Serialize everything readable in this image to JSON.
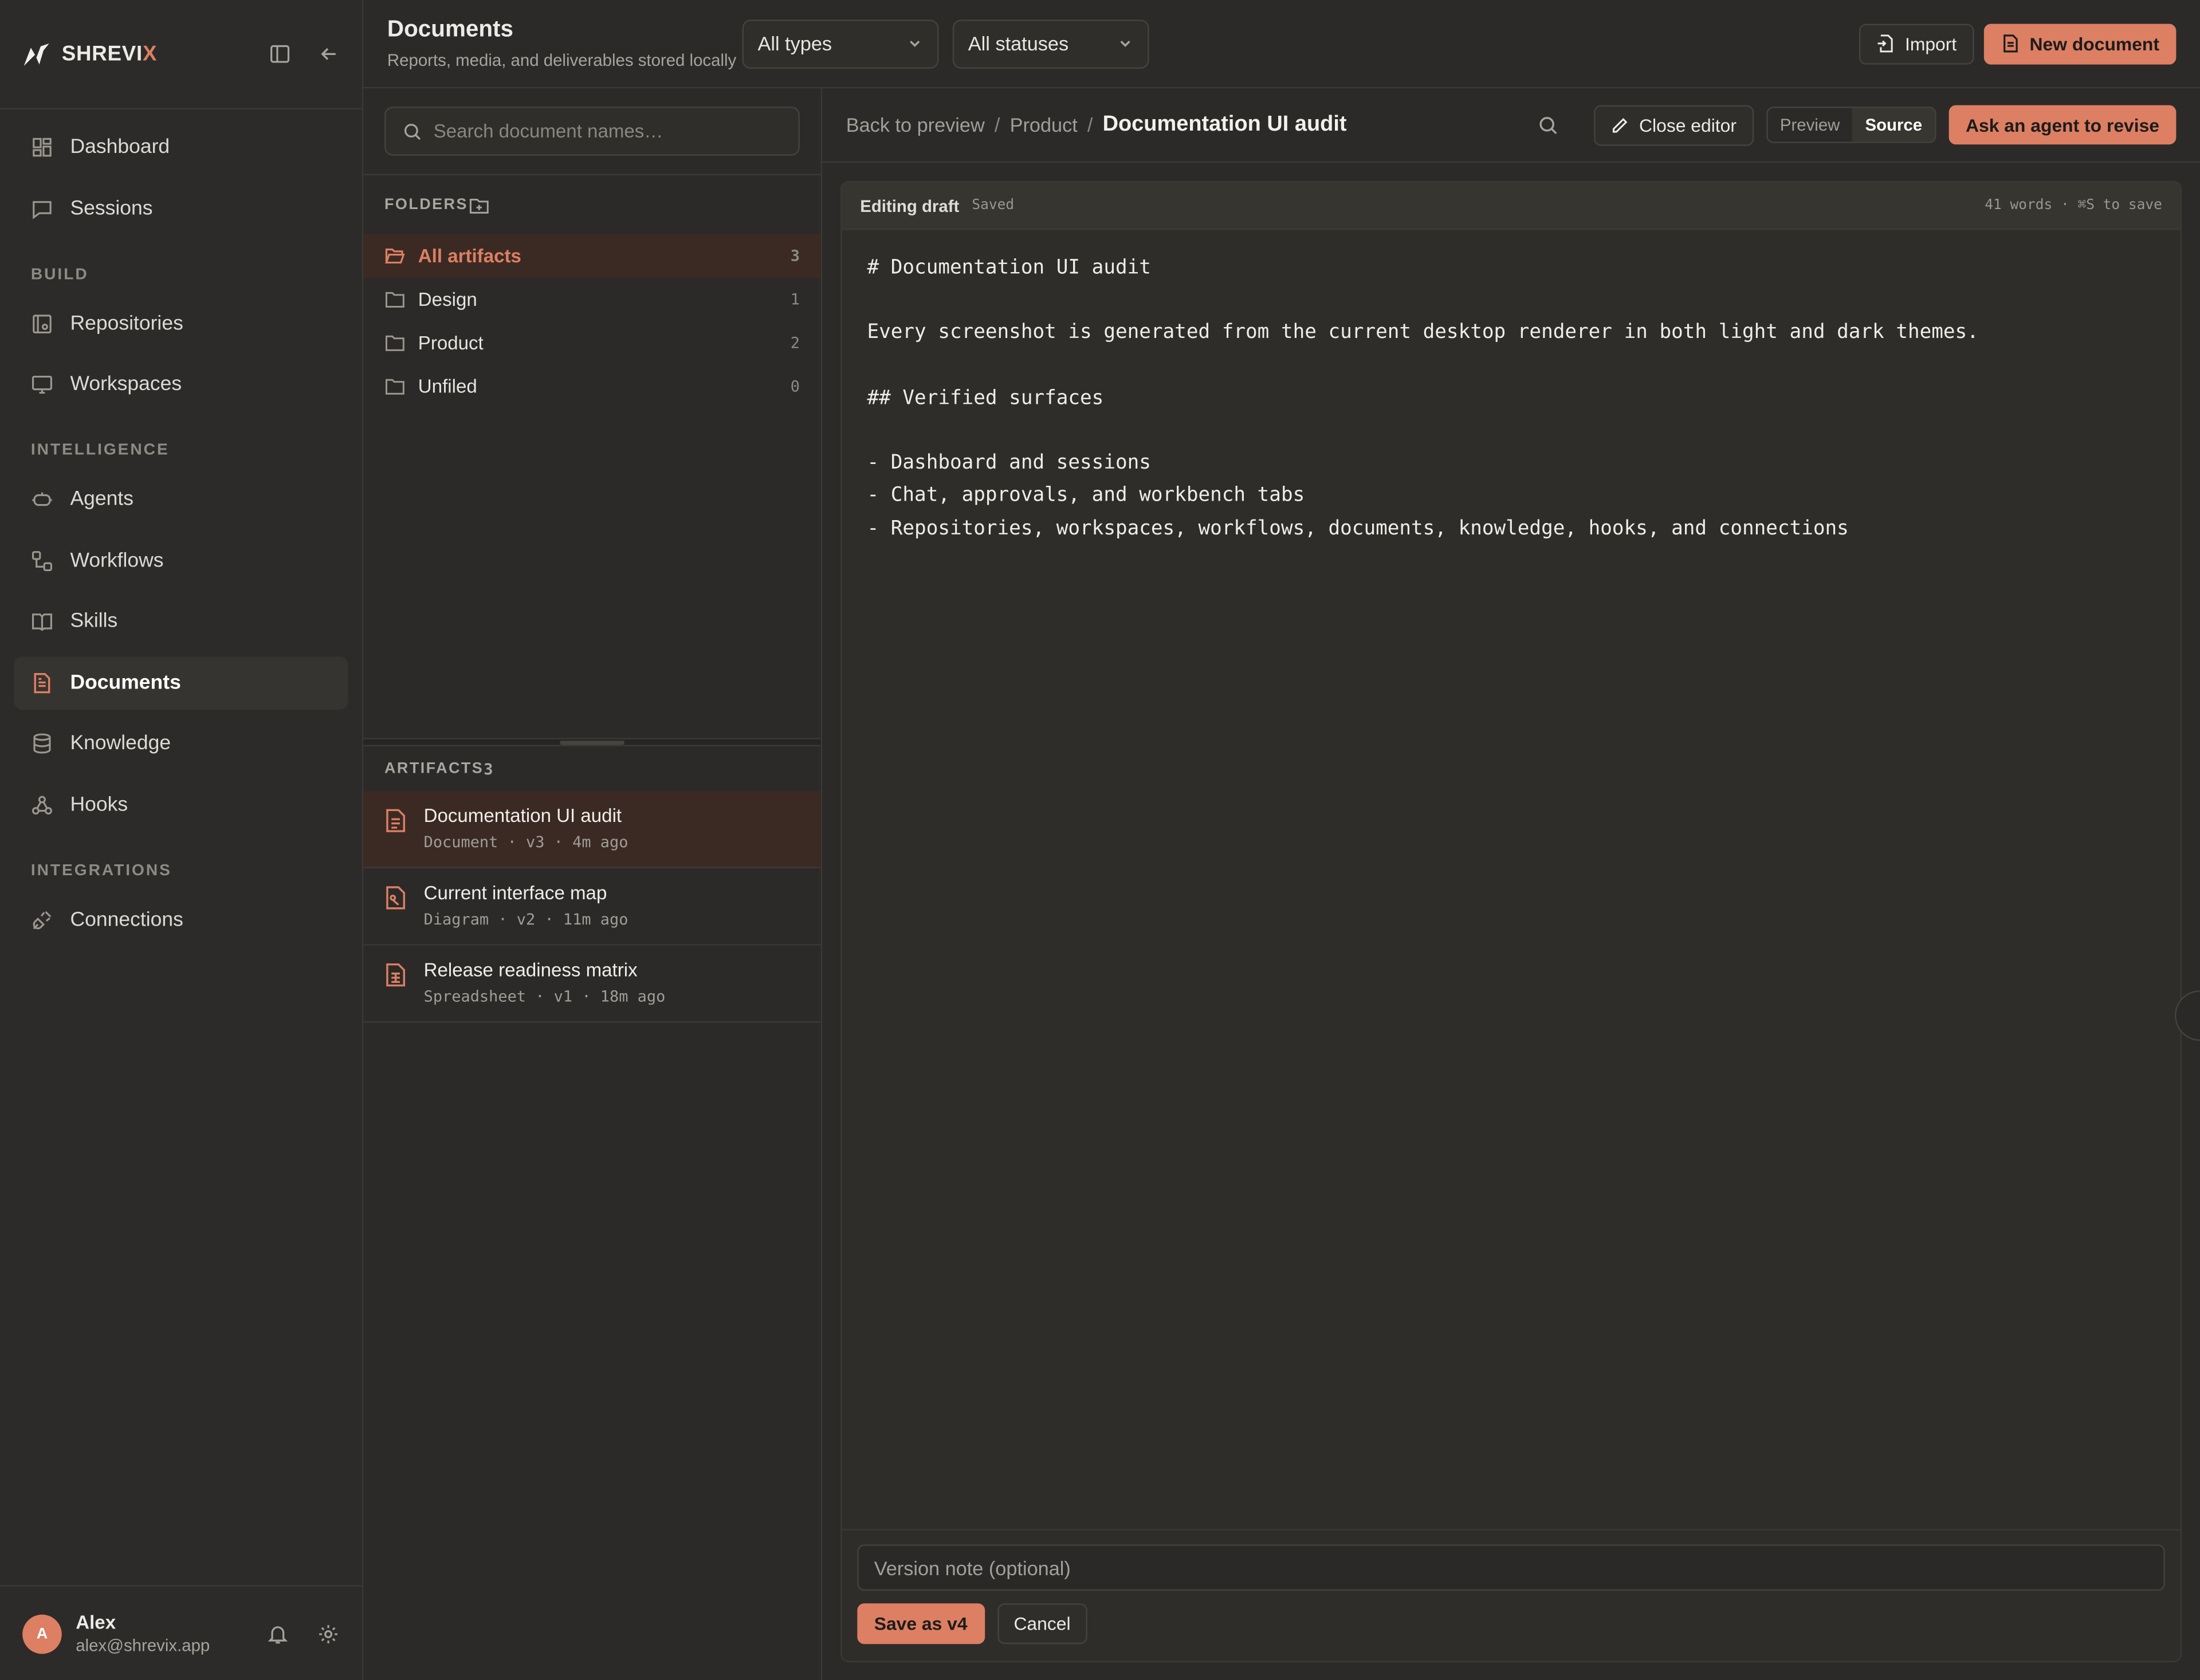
{
  "brand": {
    "name_main": "SHREVI",
    "name_accent": "X"
  },
  "nav": {
    "items_top": [
      {
        "label": "Dashboard",
        "icon": "grid-icon"
      },
      {
        "label": "Sessions",
        "icon": "chat-icon"
      }
    ],
    "sections": [
      {
        "title": "BUILD",
        "items": [
          {
            "label": "Repositories",
            "icon": "repo-icon"
          },
          {
            "label": "Workspaces",
            "icon": "monitor-icon"
          }
        ]
      },
      {
        "title": "INTELLIGENCE",
        "items": [
          {
            "label": "Agents",
            "icon": "bot-icon"
          },
          {
            "label": "Workflows",
            "icon": "workflow-icon"
          },
          {
            "label": "Skills",
            "icon": "book-icon"
          },
          {
            "label": "Documents",
            "icon": "document-icon",
            "active": true
          },
          {
            "label": "Knowledge",
            "icon": "database-icon"
          },
          {
            "label": "Hooks",
            "icon": "webhook-icon"
          }
        ]
      },
      {
        "title": "INTEGRATIONS",
        "items": [
          {
            "label": "Connections",
            "icon": "plug-icon"
          }
        ]
      }
    ]
  },
  "user": {
    "initial": "A",
    "name": "Alex",
    "email": "alex@shrevix.app"
  },
  "header": {
    "title": "Documents",
    "subtitle": "Reports, media, and deliverables stored locally",
    "type_filter": "All types",
    "status_filter": "All statuses",
    "import_label": "Import",
    "new_label": "New document"
  },
  "search": {
    "placeholder": "Search document names…"
  },
  "folders": {
    "title": "FOLDERS",
    "items": [
      {
        "label": "All artifacts",
        "count": "3",
        "active": true
      },
      {
        "label": "Design",
        "count": "1"
      },
      {
        "label": "Product",
        "count": "2"
      },
      {
        "label": "Unfiled",
        "count": "0"
      }
    ]
  },
  "artifacts": {
    "title": "ARTIFACTS",
    "count": "3",
    "items": [
      {
        "title": "Documentation UI audit",
        "meta": "Document · v3 · 4m ago",
        "icon": "document-icon",
        "active": true
      },
      {
        "title": "Current interface map",
        "meta": "Diagram · v2 · 11m ago",
        "icon": "diagram-file-icon"
      },
      {
        "title": "Release readiness matrix",
        "meta": "Spreadsheet · v1 · 18m ago",
        "icon": "spreadsheet-icon"
      }
    ]
  },
  "editor": {
    "crumb_back": "Back to preview",
    "crumb_folder": "Product",
    "crumb_current": "Documentation UI audit",
    "close_label": "Close editor",
    "tab_preview": "Preview",
    "tab_source": "Source",
    "agent_label": "Ask an agent to revise",
    "state": "Editing draft",
    "saved": "Saved",
    "counts": "41 words · ⌘S to save",
    "source": "# Documentation UI audit\n\nEvery screenshot is generated from the current desktop renderer in both light and dark themes.\n\n## Verified surfaces\n\n- Dashboard and sessions\n- Chat, approvals, and workbench tabs\n- Repositories, workspaces, workflows, documents, knowledge, hooks, and connections",
    "note_placeholder": "Version note (optional)",
    "save_label": "Save as v4",
    "cancel_label": "Cancel"
  },
  "colors": {
    "accent": "#dd7f63",
    "background": "#2b2a28",
    "selected": "#3b2a24"
  }
}
